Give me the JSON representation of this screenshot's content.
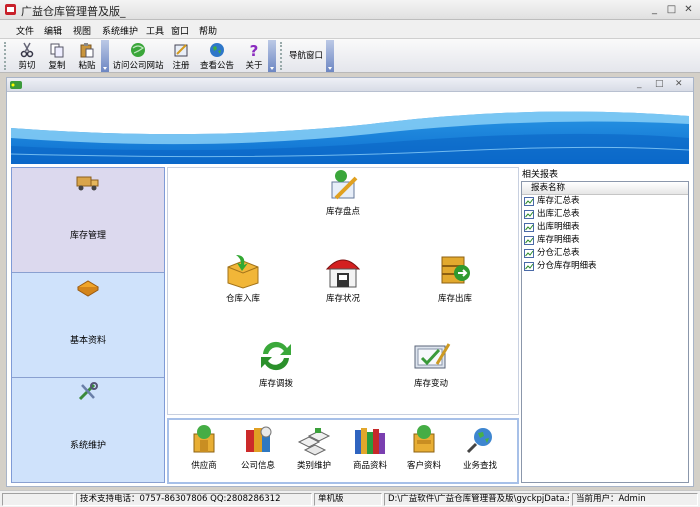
{
  "window": {
    "title": "广益仓库管理普及版_"
  },
  "menu": [
    "文件",
    "编辑",
    "视图",
    "系统维护",
    "工具",
    "窗口",
    "帮助"
  ],
  "toolbar": {
    "buttons": [
      "剪切",
      "复制",
      "粘贴",
      "访问公司网站",
      "注册",
      "查看公告",
      "关于"
    ],
    "nav_window": "导航窗口"
  },
  "left_nav": [
    {
      "label": "库存管理",
      "icon": "truck-icon",
      "active": true
    },
    {
      "label": "基本资料",
      "icon": "book-icon",
      "active": false
    },
    {
      "label": "系统维护",
      "icon": "tools-icon",
      "active": false
    }
  ],
  "content": {
    "items": [
      {
        "label": "库存盘点",
        "icon": "inventory-check-icon"
      },
      {
        "label": "仓库入库",
        "icon": "stock-in-box-icon"
      },
      {
        "label": "库存状况",
        "icon": "warehouse-status-icon"
      },
      {
        "label": "库存出库",
        "icon": "stock-out-box-icon"
      },
      {
        "label": "库存调拨",
        "icon": "transfer-arrows-icon"
      },
      {
        "label": "库存变动",
        "icon": "inventory-change-icon"
      }
    ]
  },
  "bottom": {
    "items": [
      {
        "label": "供应商",
        "icon": "supplier-icon"
      },
      {
        "label": "公司信息",
        "icon": "company-info-icon"
      },
      {
        "label": "类别维护",
        "icon": "category-icon"
      },
      {
        "label": "商品资料",
        "icon": "product-books-icon"
      },
      {
        "label": "客户资料",
        "icon": "customer-icon"
      },
      {
        "label": "业务查找",
        "icon": "search-globe-icon"
      }
    ]
  },
  "reports": {
    "title": "相关报表",
    "column": "报表名称",
    "items": [
      "库存汇总表",
      "出库汇总表",
      "出库明细表",
      "库存明细表",
      "分仓汇总表",
      "分仓库存明细表"
    ]
  },
  "status": {
    "support": "技术支持电话：0757-86307806 QQ:2808286312",
    "mode": "单机版",
    "path": "D:\\广益软件\\广益仓库管理普及版\\gyckpjData.sys",
    "user": "当前用户：Admin"
  },
  "colors": {
    "banner_top": "#ffffff",
    "banner_blue": "#1d8fe0",
    "nav_active": "#dcd9ee",
    "nav_normal": "#cfe2fb"
  }
}
